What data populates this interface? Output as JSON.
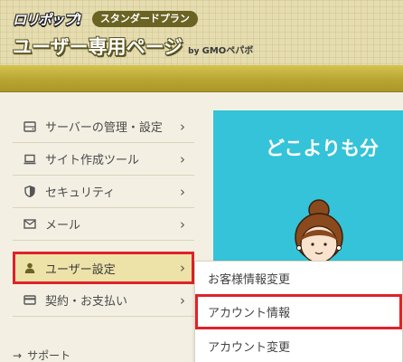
{
  "header": {
    "logo_text": "ロリポップ!",
    "plan_badge": "スタンダードプラン",
    "page_title": "ユーザー専用ページ",
    "brand_by": "by",
    "brand_name": "GMOペパボ"
  },
  "sidebar": {
    "items": [
      {
        "label": "サーバーの管理・設定",
        "icon": "server-icon"
      },
      {
        "label": "サイト作成ツール",
        "icon": "laptop-icon"
      },
      {
        "label": "セキュリティ",
        "icon": "shield-icon"
      },
      {
        "label": "メール",
        "icon": "mail-icon"
      },
      {
        "label": "ユーザー設定",
        "icon": "user-icon",
        "active": true
      },
      {
        "label": "契約・お支払い",
        "icon": "credit-card-icon"
      }
    ],
    "support_label": "サポート"
  },
  "main": {
    "hero_text": "どこよりも分"
  },
  "submenu": {
    "items": [
      {
        "label": "お客様情報変更"
      },
      {
        "label": "アカウント情報",
        "highlighted": true
      },
      {
        "label": "アカウント変更"
      }
    ]
  },
  "colors": {
    "gold_band": "#b9a631",
    "highlight_red": "#e0212a",
    "hero_blue": "#34c3d8",
    "plan_badge": "#6b6323"
  }
}
